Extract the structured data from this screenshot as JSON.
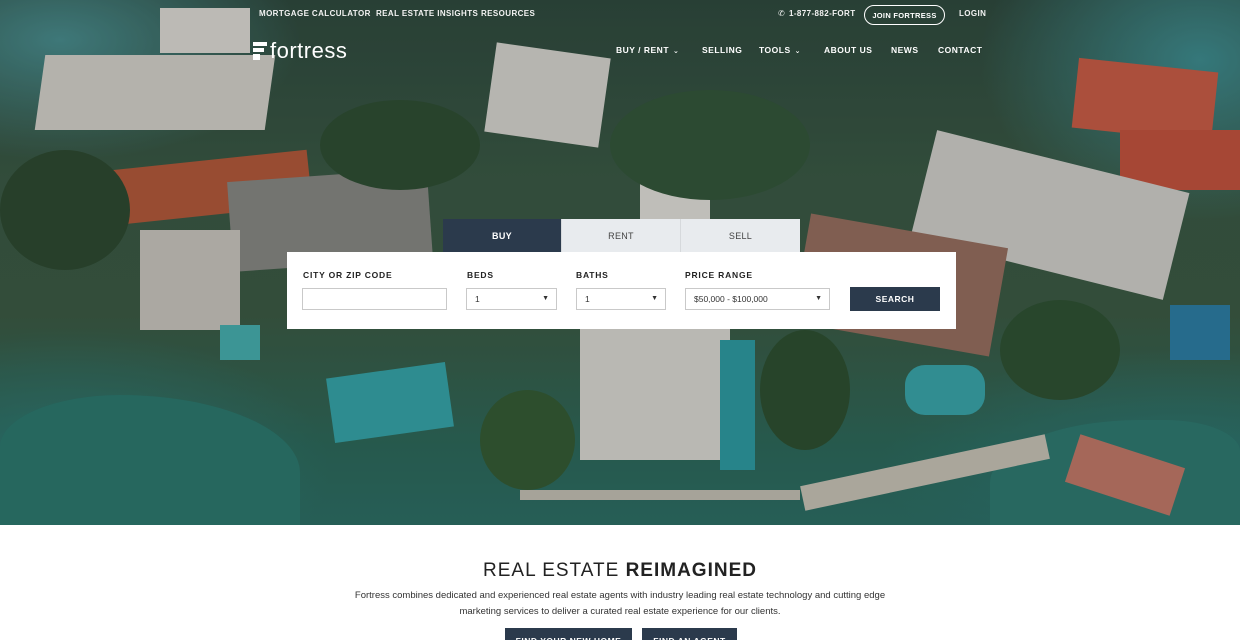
{
  "utility_nav": {
    "mortgage_calculator": "MORTGAGE CALCULATOR",
    "real_estate_insights": "REAL ESTATE INSIGHTS",
    "resources": "RESOURCES",
    "phone": "1-877-882-FORT",
    "join_button": "JOIN FORTRESS",
    "login": "LOGIN"
  },
  "brand": {
    "name": "fortress"
  },
  "main_nav": {
    "buy_rent": "BUY / RENT",
    "selling": "SELLING",
    "tools": "TOOLS",
    "about_us": "ABOUT US",
    "news": "NEWS",
    "contact": "CONTACT"
  },
  "search": {
    "tabs": [
      "BUY",
      "RENT",
      "SELL"
    ],
    "active_tab": "BUY",
    "city_label": "CITY OR ZIP CODE",
    "city_value": "",
    "beds_label": "BEDS",
    "beds_value": "1",
    "baths_label": "BATHS",
    "baths_value": "1",
    "price_label": "PRICE RANGE",
    "price_value": "$50,000 - $100,000",
    "search_button": "SEARCH"
  },
  "intro": {
    "title_light": "REAL ESTATE ",
    "title_bold": "REIMAGINED",
    "text": "Fortress combines dedicated and experienced real estate agents with industry leading real estate technology and cutting edge marketing services to deliver a curated real estate experience for our clients.",
    "cta_home": "FIND YOUR NEW HOME",
    "cta_agent": "FIND AN AGENT"
  },
  "colors": {
    "navy": "#2b3a4c",
    "tab_inactive": "#e8ebee",
    "white": "#ffffff"
  },
  "icons": {
    "phone": "phone-icon",
    "caret": "chevron-down-icon"
  }
}
